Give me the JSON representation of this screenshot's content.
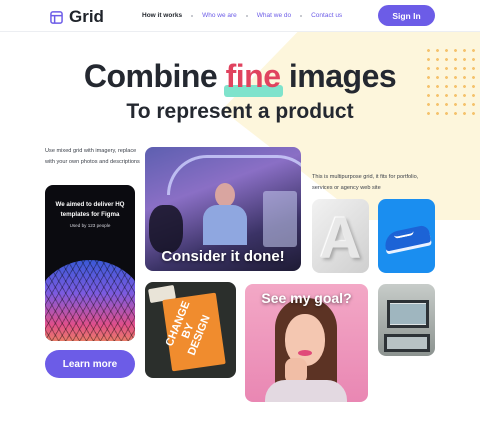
{
  "brand": {
    "name": "Grid",
    "accent": "#6c5ce7",
    "highlight_text": "#e0435f",
    "highlight_bar": "#7fe3cc"
  },
  "nav": {
    "items": [
      {
        "label": "How it works",
        "active": true
      },
      {
        "label": "Who we are",
        "active": false
      },
      {
        "label": "What we do",
        "active": false
      },
      {
        "label": "Contact us",
        "active": false
      }
    ],
    "signin_label": "Sign In"
  },
  "hero": {
    "title_before": "Combine",
    "title_highlight": "fine",
    "title_after": "images",
    "subtitle": "To represent a product"
  },
  "left_description": "Use mixed grid with imagery, replace with your own photos and descriptions",
  "right_description": "This is multipurpose grid, it fits for portfolio, services or agency web site",
  "promo": {
    "title": "We aimed to deliver HQ templates for Figma",
    "subtitle": "Used by 123 people"
  },
  "tiles": {
    "meeting_caption": "Consider it done!",
    "a_letter": "A",
    "book_text": "CHANGE BY DESIGN",
    "woman_caption": "See my goal?"
  },
  "learn_more_label": "Learn more",
  "icons": {
    "logo": "grid-layout-icon"
  }
}
